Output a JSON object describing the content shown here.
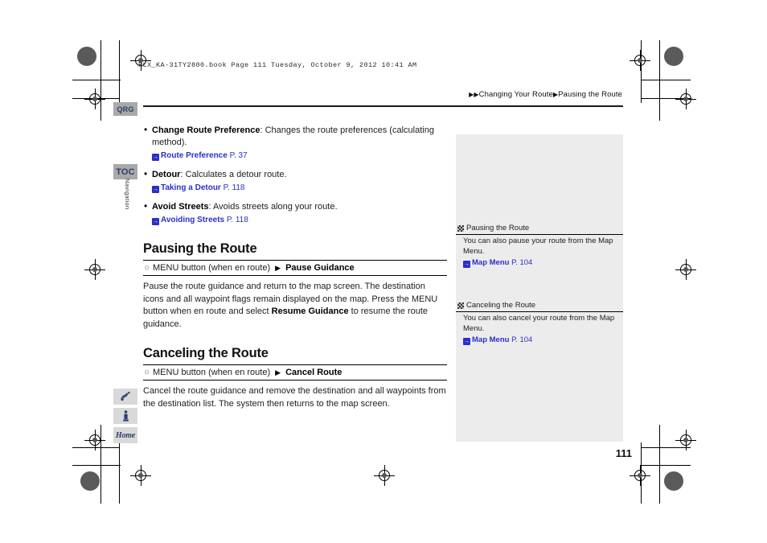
{
  "document": {
    "print_header": "RLX_KA-31TY2800.book  Page 111  Tuesday, October 9, 2012  10:41 AM",
    "page_number": "111"
  },
  "breadcrumb": {
    "arrow": "▶",
    "level1": "Changing Your Route",
    "level2": "Pausing the Route"
  },
  "rail": {
    "qrg_label": "QRG",
    "toc_label": "TOC",
    "section_label": "Navigation",
    "icon_voice": "voice-command-icon",
    "icon_info": "information-icon",
    "icon_home": "Home"
  },
  "bullets": [
    {
      "term": "Change Route Preference",
      "desc": ": Changes the route preferences (calculating method).",
      "xref_icon": "→",
      "xref_name": "Route Preference",
      "xref_page": "P. 37"
    },
    {
      "term": "Detour",
      "desc": ": Calculates a detour route.",
      "xref_icon": "→",
      "xref_name": "Taking a Detour",
      "xref_page": "P. 118"
    },
    {
      "term": "Avoid Streets",
      "desc": ": Avoids streets along your route.",
      "xref_icon": "→",
      "xref_name": "Avoiding Streets",
      "xref_page": "P. 118"
    }
  ],
  "sections": [
    {
      "title": "Pausing the Route",
      "proc_button": "MENU button (when en route)",
      "proc_arrow": "▶",
      "proc_target": "Pause Guidance",
      "body_pre": "Pause the route guidance and return to the map screen. The destination icons and all waypoint flags remain displayed on the map. Press the MENU button when en route and select ",
      "body_bold": "Resume Guidance",
      "body_post": " to resume the route guidance."
    },
    {
      "title": "Canceling the Route",
      "proc_button": "MENU button (when en route)",
      "proc_arrow": "▶",
      "proc_target": "Cancel Route",
      "body_pre": "Cancel the route guidance and remove the destination and all waypoints from the destination list. The system then returns to the map screen.",
      "body_bold": "",
      "body_post": ""
    }
  ],
  "notes": [
    {
      "heading": "Pausing the Route",
      "text": "You can also pause your route from the Map Menu.",
      "xref_icon": "→",
      "xref_name": "Map Menu",
      "xref_page": "P. 104"
    },
    {
      "heading": "Canceling the Route",
      "text": "You can also cancel your route from the Map Menu.",
      "xref_icon": "→",
      "xref_name": "Map Menu",
      "xref_page": "P. 104"
    }
  ],
  "colors": {
    "xref_blue": "#2930c8",
    "tab_gray": "#a9a9a9",
    "tab_text": "#2b3d6b",
    "note_bg": "#ececec"
  }
}
